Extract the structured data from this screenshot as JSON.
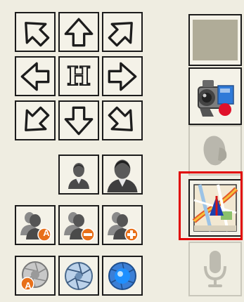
{
  "ptz": {
    "up_left": "arrow-up-left-icon",
    "up": "arrow-up-icon",
    "up_right": "arrow-up-right-icon",
    "left": "arrow-left-icon",
    "home": "home-icon",
    "home_letter": "H",
    "right": "arrow-right-icon",
    "down_left": "arrow-down-left-icon",
    "down": "arrow-down-icon",
    "down_right": "arrow-down-right-icon"
  },
  "zoom": {
    "zoom_out": "person-small-icon",
    "zoom_in": "person-large-icon"
  },
  "focus": {
    "auto": "focus-auto-icon",
    "auto_badge": "A",
    "minus": "focus-minus-icon",
    "plus": "focus-plus-icon"
  },
  "iris": {
    "auto": "iris-auto-icon",
    "auto_badge": "A",
    "close": "iris-close-icon",
    "open": "iris-open-icon"
  },
  "side_panel": {
    "items": [
      {
        "icon": "blank-panel-icon",
        "enabled": true
      },
      {
        "icon": "video-camera-record-icon",
        "enabled": true
      },
      {
        "icon": "snapshot-icon",
        "enabled": false
      },
      {
        "icon": "map-icon",
        "enabled": true,
        "highlighted": true
      },
      {
        "icon": "microphone-icon",
        "enabled": false
      }
    ]
  },
  "colors": {
    "background": "#efede1",
    "border": "#1c1c1c",
    "highlight": "#e00000",
    "badge_orange": "#e8701a"
  }
}
